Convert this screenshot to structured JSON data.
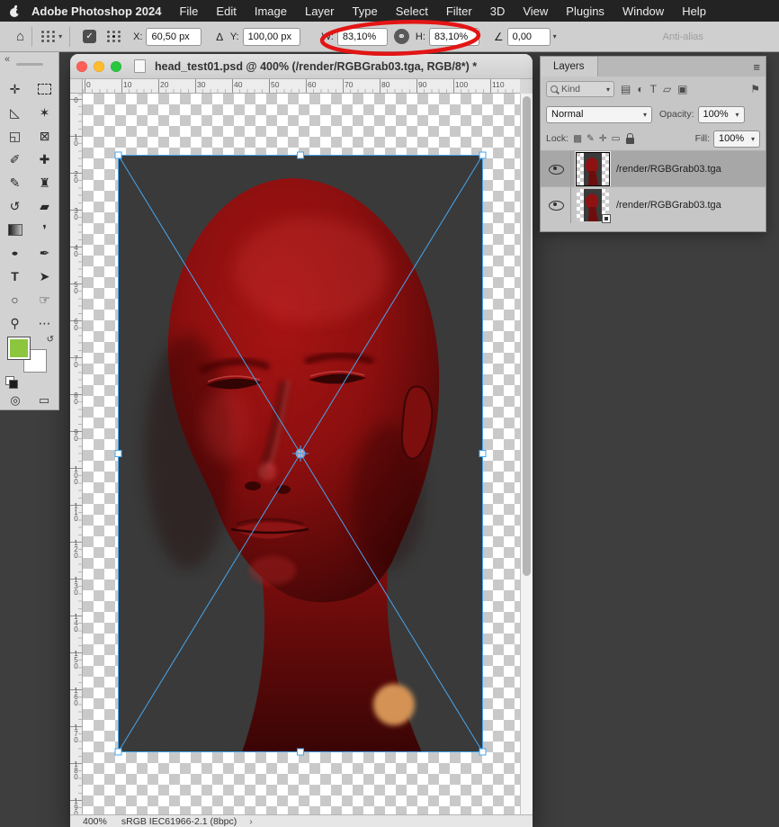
{
  "menubar": {
    "app_name": "Adobe Photoshop 2024",
    "items": [
      "File",
      "Edit",
      "Image",
      "Layer",
      "Type",
      "Select",
      "Filter",
      "3D",
      "View",
      "Plugins",
      "Window",
      "Help"
    ]
  },
  "ui": {
    "chevron_down": "▾",
    "double_chevron": "«",
    "close_glyph": "✕",
    "menu_glyph": "≡",
    "status_chevron": "›"
  },
  "options_bar": {
    "home_glyph": "⌂",
    "check_glyph": "✓",
    "x_label": "X:",
    "x_value": "60,50 px",
    "delta_glyph": "∆",
    "y_label": "Y:",
    "y_value": "100,00 px",
    "w_label": "W:",
    "w_value": "83,10%",
    "link_glyph": "⚭",
    "h_label": "H:",
    "h_value": "83,10%",
    "angle_glyph": "∠",
    "angle_value": "0,00",
    "anti_alias_label": "Anti-alias"
  },
  "toolbar": {
    "tools": [
      {
        "id": "move",
        "glyph": "✛"
      },
      {
        "id": "lasso",
        "glyph": "◺"
      },
      {
        "id": "object-selection",
        "glyph": "✶"
      },
      {
        "id": "crop",
        "glyph": "◱"
      },
      {
        "id": "frame",
        "glyph": "⊠"
      },
      {
        "id": "eyedropper",
        "glyph": "✐"
      },
      {
        "id": "healing-brush",
        "glyph": "✚"
      },
      {
        "id": "brush",
        "glyph": "✎"
      },
      {
        "id": "clone-stamp",
        "glyph": "♜"
      },
      {
        "id": "history-brush",
        "glyph": "↺"
      },
      {
        "id": "eraser",
        "glyph": "▰"
      },
      {
        "id": "blur",
        "glyph": "❜"
      },
      {
        "id": "dodge",
        "glyph": "●"
      },
      {
        "id": "pen",
        "glyph": "✒"
      },
      {
        "id": "type",
        "glyph": "T"
      },
      {
        "id": "path-selection",
        "glyph": "➤"
      },
      {
        "id": "shape",
        "glyph": "○"
      },
      {
        "id": "hand",
        "glyph": "☞"
      },
      {
        "id": "zoom",
        "glyph": "⚲"
      },
      {
        "id": "more",
        "glyph": "⋯"
      }
    ],
    "quick_mask_glyph": "◎",
    "screen_mode_glyph": "▭",
    "foreground_color": "#8cc63f",
    "background_color": "#ffffff"
  },
  "document_window": {
    "title": "head_test01.psd @ 400% (/render/RGBGrab03.tga, RGB/8*) *",
    "ruler_h": [
      "0",
      "10",
      "20",
      "30",
      "40",
      "50",
      "60",
      "70",
      "80",
      "90",
      "100",
      "110"
    ],
    "ruler_v": [
      "0",
      "10",
      "20",
      "30",
      "40",
      "50",
      "60",
      "70",
      "80",
      "90",
      "100",
      "110",
      "120",
      "130",
      "140",
      "150",
      "160",
      "170",
      "180",
      "190"
    ],
    "status_zoom": "400%",
    "status_profile": "sRGB IEC61966-2.1 (8bpc)"
  },
  "layers_panel": {
    "tab_label": "Layers",
    "kind_label": "Kind",
    "filter_icons": [
      {
        "id": "filter-pixel-layers",
        "glyph": "▤"
      },
      {
        "id": "filter-adjustment-layers",
        "glyph": "◐"
      },
      {
        "id": "filter-type-layers",
        "glyph": "T"
      },
      {
        "id": "filter-shape-layers",
        "glyph": "▱"
      },
      {
        "id": "filter-smart-objects",
        "glyph": "▣"
      }
    ],
    "pin_glyph": "⚑",
    "blend_mode": "Normal",
    "opacity_label": "Opacity:",
    "opacity_value": "100%",
    "lock_label": "Lock:",
    "lock_icons": [
      {
        "id": "lock-transparency",
        "glyph": "▩"
      },
      {
        "id": "lock-paint",
        "glyph": "✎"
      },
      {
        "id": "lock-position",
        "glyph": "✛"
      },
      {
        "id": "lock-artboard",
        "glyph": "▭"
      }
    ],
    "fill_label": "Fill:",
    "fill_value": "100%",
    "layers": [
      {
        "name": "/render/RGBGrab03.tga"
      },
      {
        "name": "/render/RGBGrab03.tga"
      }
    ]
  },
  "colors": {
    "annotation_red": "#e31515",
    "transform_blue": "#46a6ef"
  }
}
